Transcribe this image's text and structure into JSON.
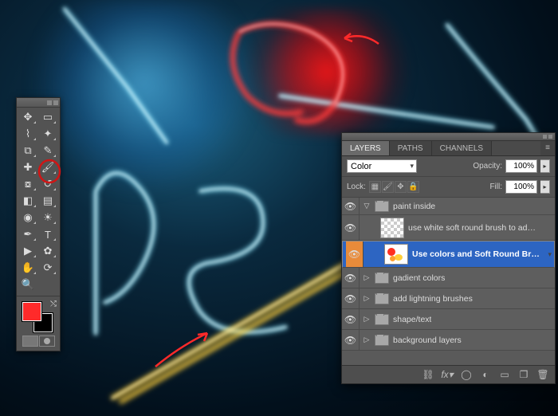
{
  "app": "Adobe Photoshop",
  "toolbox": {
    "tools": [
      "move",
      "marquee",
      "lasso",
      "magic-wand",
      "crop",
      "eyedropper",
      "healing",
      "brush",
      "clone",
      "history-brush",
      "eraser",
      "gradient",
      "blur",
      "dodge",
      "pen",
      "type",
      "path-select",
      "shape",
      "hand",
      "rotate",
      "zoom",
      ""
    ],
    "foreground_color": "#ff2a2a",
    "background_color": "#000000"
  },
  "panel": {
    "tabs": [
      "LAYERS",
      "PATHS",
      "CHANNELS"
    ],
    "active_tab": "LAYERS",
    "blend_mode": "Color",
    "opacity": "100%",
    "lock_label": "Lock:",
    "fill_label": "Fill:",
    "fill": "100%",
    "opacity_label": "Opacity:",
    "layers": [
      {
        "type": "group",
        "name": "paint inside",
        "open": true,
        "eye": true
      },
      {
        "type": "layer",
        "name": "use white soft round brush to add...",
        "eye": true,
        "thumb": "checker"
      },
      {
        "type": "layer",
        "name": "Use colors and Soft Round Bru...",
        "eye": true,
        "selected": true,
        "thumb": "paint"
      },
      {
        "type": "group",
        "name": "gadient colors",
        "eye": true
      },
      {
        "type": "group",
        "name": "add lightning brushes",
        "eye": true
      },
      {
        "type": "group",
        "name": "shape/text",
        "eye": true
      },
      {
        "type": "group",
        "name": "background layers",
        "eye": true
      }
    ],
    "footer_icons": [
      "link",
      "fx",
      "mask",
      "adjust",
      "group",
      "new",
      "trash"
    ]
  },
  "annotations": {
    "arrows": [
      "top-right pointing to red glow",
      "bottom pointing to yellow bolt"
    ],
    "circles": [
      "brush tool in toolbox",
      "layer thumbnails in panel"
    ]
  }
}
